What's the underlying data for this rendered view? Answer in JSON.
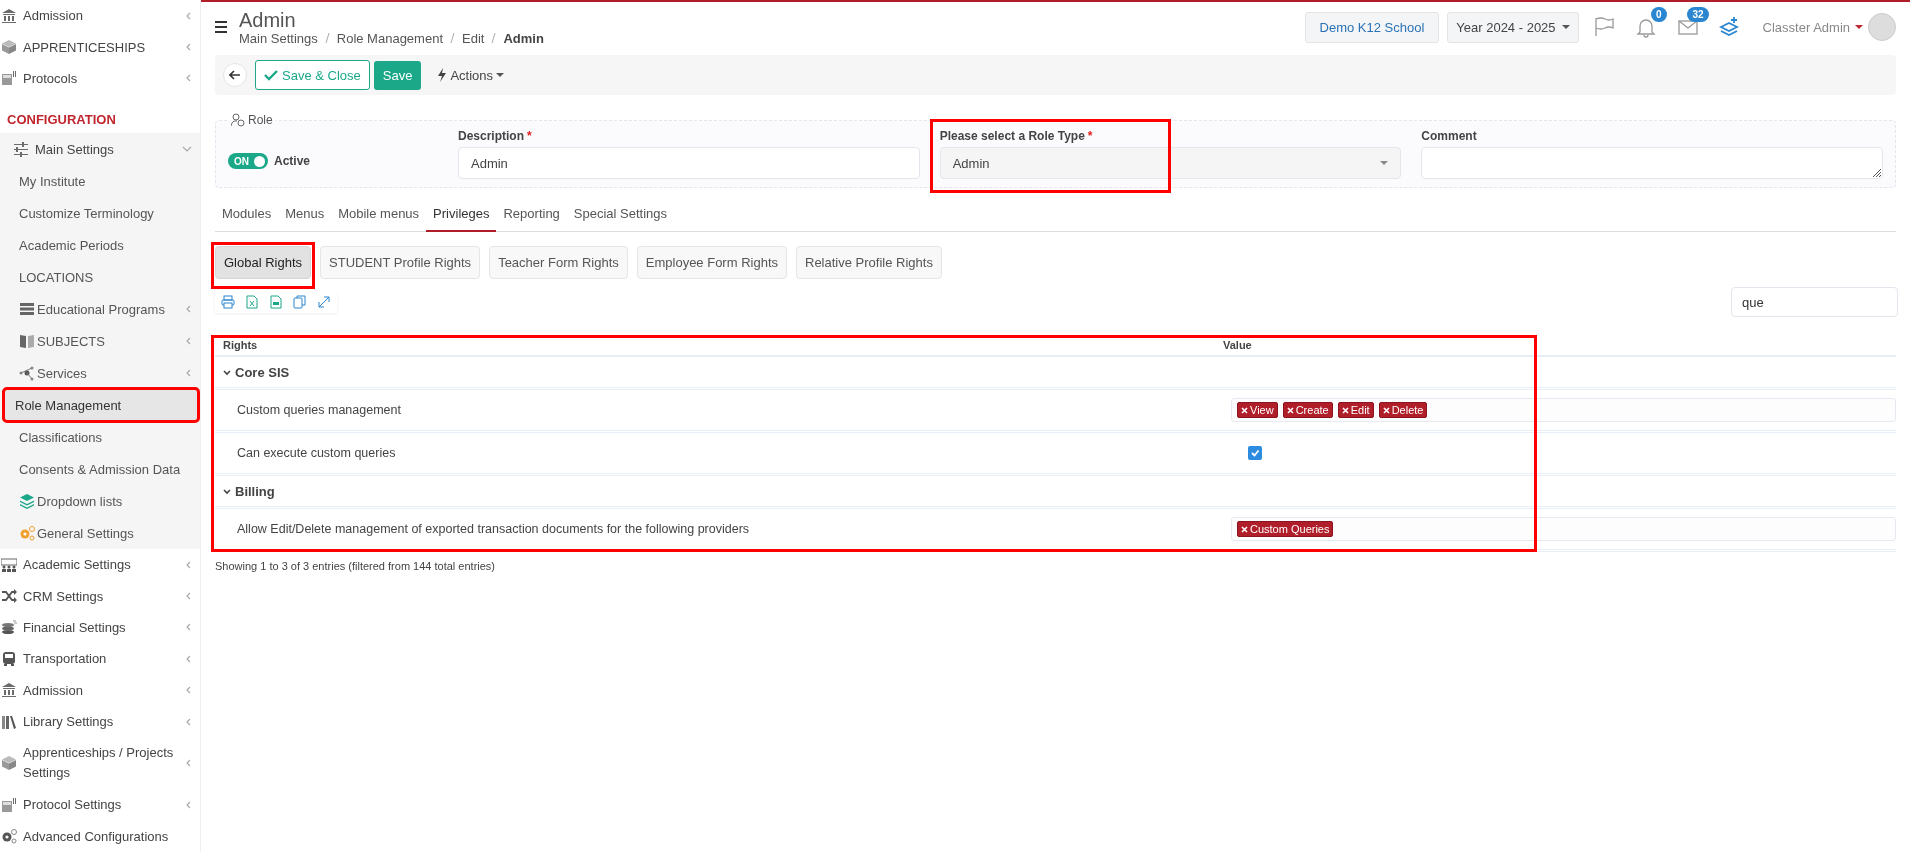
{
  "sidebar": {
    "items": [
      {
        "kind": "group",
        "label": "Admission",
        "expanded": false
      },
      {
        "kind": "group",
        "label": "APPRENTICESHIPS",
        "expanded": false
      },
      {
        "kind": "group",
        "label": "Protocols",
        "expanded": false
      },
      {
        "kind": "heading",
        "label": "CONFIGURATION"
      },
      {
        "kind": "group",
        "label": "Main Settings",
        "expanded": true,
        "children": [
          {
            "label": "My Institute",
            "selected": false,
            "highlighted": false
          },
          {
            "label": "Customize Terminology",
            "selected": false,
            "highlighted": false
          },
          {
            "label": "Academic Periods",
            "selected": false,
            "highlighted": false
          },
          {
            "label": "LOCATIONS",
            "selected": false,
            "highlighted": false
          },
          {
            "label": "Educational Programs",
            "selected": false,
            "highlighted": false,
            "expanded": false
          },
          {
            "label": "SUBJECTS",
            "selected": false,
            "highlighted": false,
            "expanded": false
          },
          {
            "label": "Services",
            "selected": false,
            "highlighted": false,
            "expanded": false
          },
          {
            "label": "Role Management",
            "selected": true,
            "highlighted": true
          },
          {
            "label": "Classifications",
            "selected": false,
            "highlighted": false
          },
          {
            "label": "Consents & Admission Data",
            "selected": false,
            "highlighted": false
          },
          {
            "label": "Dropdown lists",
            "selected": false,
            "highlighted": false
          },
          {
            "label": "General Settings",
            "selected": false,
            "highlighted": false
          }
        ]
      },
      {
        "kind": "group",
        "label": "Academic Settings",
        "expanded": false
      },
      {
        "kind": "group",
        "label": "CRM Settings",
        "expanded": false
      },
      {
        "kind": "group",
        "label": "Financial Settings",
        "expanded": false
      },
      {
        "kind": "group",
        "label": "Transportation",
        "expanded": false
      },
      {
        "kind": "group",
        "label": "Admission",
        "expanded": false
      },
      {
        "kind": "group",
        "label": "Library Settings",
        "expanded": false
      },
      {
        "kind": "group",
        "label": "Apprenticeships / Projects Settings",
        "expanded": false
      },
      {
        "kind": "group",
        "label": "Protocol Settings",
        "expanded": false
      },
      {
        "kind": "group",
        "label": "Advanced Configurations"
      }
    ]
  },
  "header": {
    "title": "Admin",
    "breadcrumb": [
      "Main Settings",
      "Role Management",
      "Edit",
      "Admin"
    ],
    "school": "Demo K12 School",
    "year": "Year 2024 - 2025",
    "notifications": "0",
    "messages": "32",
    "user": "Classter Admin"
  },
  "toolbar": {
    "save_close": "Save & Close",
    "save": "Save",
    "actions": "Actions"
  },
  "role": {
    "legend": "Role",
    "active": {
      "on": true,
      "switch_label": "ON",
      "label": "Active"
    },
    "description": {
      "label": "Description",
      "required_mark": "*",
      "value": "Admin"
    },
    "role_type": {
      "label": "Please select a Role Type",
      "required_mark": "*",
      "value": "Admin",
      "highlighted": true
    },
    "comment": {
      "label": "Comment"
    }
  },
  "tabs": [
    {
      "label": "Modules",
      "selected": false
    },
    {
      "label": "Menus",
      "selected": false
    },
    {
      "label": "Mobile menus",
      "selected": false
    },
    {
      "label": "Privileges",
      "selected": true
    },
    {
      "label": "Reporting",
      "selected": false
    },
    {
      "label": "Special Settings",
      "selected": false
    }
  ],
  "subtabs": [
    {
      "label": "Global Rights",
      "selected": true,
      "highlighted": true
    },
    {
      "label": "STUDENT Profile Rights",
      "selected": false,
      "highlighted": false
    },
    {
      "label": "Teacher Form Rights",
      "selected": false,
      "highlighted": false
    },
    {
      "label": "Employee Form Rights",
      "selected": false,
      "highlighted": false
    },
    {
      "label": "Relative Profile Rights",
      "selected": false,
      "highlighted": false
    }
  ],
  "search": {
    "value": "que"
  },
  "table": {
    "highlighted": true,
    "columns": [
      "Rights",
      "Value"
    ],
    "groups": [
      {
        "name": "Core SIS",
        "expanded": true,
        "rows": [
          {
            "label": "Custom queries management",
            "kind": "tags",
            "tags": [
              "View",
              "Create",
              "Edit",
              "Delete"
            ]
          },
          {
            "label": "Can execute custom queries",
            "kind": "checkbox",
            "checked": true
          }
        ]
      },
      {
        "name": "Billing",
        "expanded": true,
        "rows": [
          {
            "label": "Allow Edit/Delete management of exported transaction documents for the following providers",
            "kind": "tags",
            "tags": [
              "Custom Queries"
            ]
          }
        ]
      }
    ]
  },
  "footer": "Showing 1 to 3 of 3 entries (filtered from 144 total entries)"
}
